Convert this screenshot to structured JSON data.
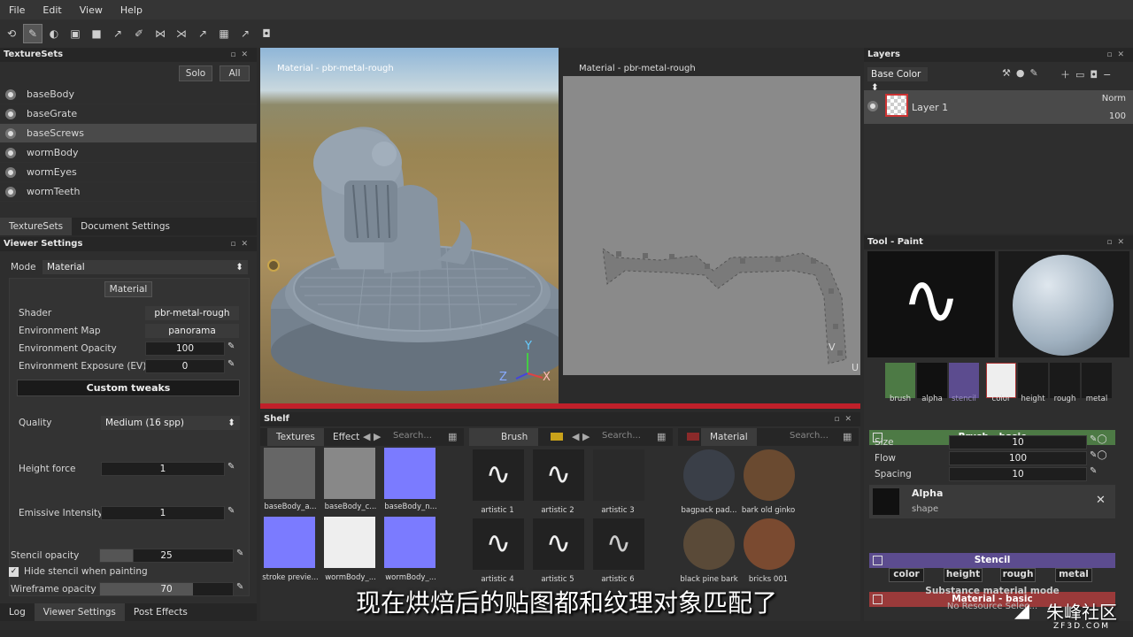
{
  "menu": [
    "File",
    "Edit",
    "View",
    "Help"
  ],
  "texture_sets": {
    "title": "TextureSets",
    "solo": "Solo",
    "all": "All",
    "items": [
      "baseBody",
      "baseGrate",
      "baseScrews",
      "wormBody",
      "wormEyes",
      "wormTeeth"
    ],
    "selected_index": 2,
    "tabs": [
      "TextureSets",
      "Document Settings"
    ]
  },
  "viewer_settings": {
    "title": "Viewer Settings",
    "mode_label": "Mode",
    "mode_value": "Material",
    "material_button": "Material",
    "rows": [
      {
        "label": "Shader",
        "value": "pbr-metal-rough"
      },
      {
        "label": "Environment Map",
        "value": "panorama"
      },
      {
        "label": "Environment Opacity",
        "value": "100"
      },
      {
        "label": "Environment Exposure (EV)",
        "value": "0"
      }
    ],
    "custom_tweaks": "Custom tweaks",
    "quality_label": "Quality",
    "quality_value": "Medium (16 spp)",
    "height_force_label": "Height force",
    "height_force_value": "1",
    "emissive_label": "Emissive Intensity",
    "emissive_value": "1",
    "stencil_opacity_label": "Stencil opacity",
    "stencil_opacity_value": "25",
    "hide_stencil_label": "Hide stencil when painting",
    "wireframe_label": "Wireframe opacity",
    "wireframe_value": "70"
  },
  "bottom_tabs": [
    "Log",
    "Viewer Settings",
    "Post Effects"
  ],
  "viewport": {
    "left_title": "Material - pbr-metal-rough",
    "right_title": "Material - pbr-metal-rough",
    "axis_y": "Y",
    "axis_z": "Z",
    "axis_x": "X",
    "uv_v": "V",
    "uv_u": "U"
  },
  "shelf": {
    "title": "Shelf",
    "tabs1": [
      "Textures",
      "Effect"
    ],
    "search": "Search...",
    "brush_tab": "Brush",
    "material_tab": "Material",
    "textures": [
      "baseBody_a...",
      "baseBody_c...",
      "baseBody_n...",
      "stroke previe...",
      "wormBody_...",
      "wormBody_..."
    ],
    "brushes": [
      "artistic 1",
      "artistic 2",
      "artistic 3",
      "artistic 4",
      "artistic 5",
      "artistic 6"
    ],
    "materials": [
      "bagpack pad...",
      "bark old ginko",
      "black pine bark",
      "bricks 001"
    ]
  },
  "layers": {
    "title": "Layers",
    "channel": "Base Color",
    "layer_name": "Layer 1",
    "blend": "Norm",
    "opacity": "100"
  },
  "tool": {
    "title": "Tool - Paint",
    "slots": [
      "brush",
      "alpha",
      "stencil",
      "color",
      "height",
      "rough",
      "metal"
    ],
    "brush_basic": "Brush - basic",
    "size_label": "Size",
    "size_value": "10",
    "flow_label": "Flow",
    "flow_value": "100",
    "spacing_label": "Spacing",
    "spacing_value": "10",
    "alpha_title": "Alpha",
    "alpha_sub": "shape",
    "stencil": "Stencil",
    "material_basic": "Material - basic",
    "mat_channels": [
      "color",
      "height",
      "rough",
      "metal"
    ],
    "substance_mode": "Substance material mode",
    "no_resource": "No Resource Selec..."
  },
  "subtitle": "现在烘焙后的贴图都和纹理对象匹配了",
  "watermark": "朱峰社区",
  "watermark_url": "ZF3D.COM",
  "colors": {
    "accent_red": "#c0202a",
    "brush_green": "#4d7a45",
    "stencil_purple": "#5c4c8f",
    "material_red": "#9a3a3a"
  }
}
